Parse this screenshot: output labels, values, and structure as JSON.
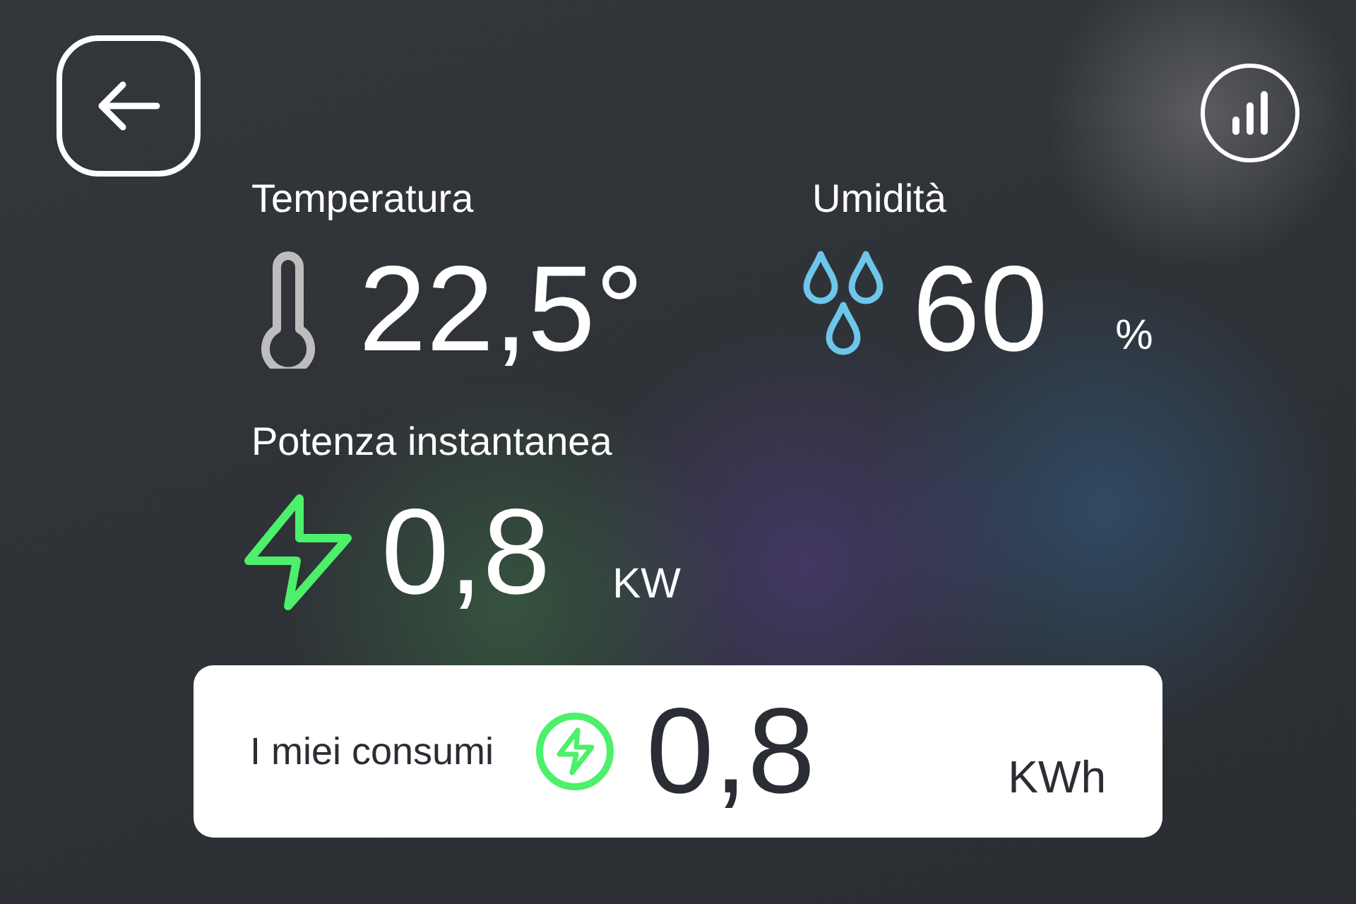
{
  "metrics": [
    {
      "kind": "temperature",
      "label": "Temperatura",
      "value": "22,5°"
    },
    {
      "kind": "humidity",
      "label": "Umidità",
      "value": "60",
      "unit": "%"
    },
    {
      "kind": "power",
      "label": "Potenza instantanea",
      "value": "0,8",
      "unit": "KW"
    }
  ],
  "consumption_card": {
    "label": "I miei consumi",
    "value": "0,8",
    "unit": "KWh"
  }
}
